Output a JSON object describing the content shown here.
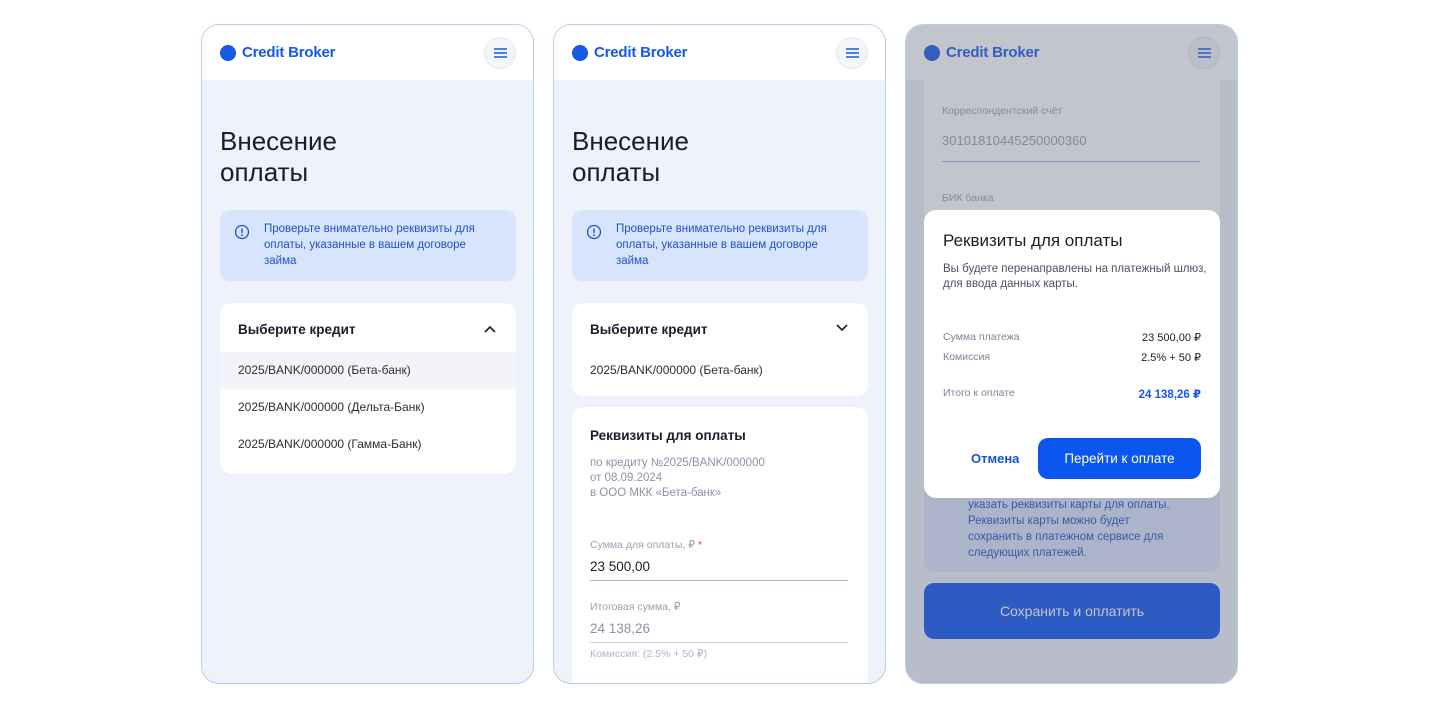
{
  "brand": {
    "name": "Credit Broker"
  },
  "colors": {
    "accent": "#0b55f0",
    "brand": "#1659ea",
    "info_bg": "#d8e4fb",
    "page_bg": "#eff2fb"
  },
  "icons": {
    "menu": "hamburger-icon",
    "info": "info-circle-icon",
    "chevron_up": "chevron-up-icon",
    "chevron_down": "chevron-down-icon"
  },
  "page": {
    "title_line1": "Внесение",
    "title_line2": "оплаты",
    "info_text": "Проверьте внимательно реквизиты для оплаты, указанные в вашем договоре займа"
  },
  "credit_select": {
    "label": "Выберите кредит",
    "options": [
      "2025/BANK/000000 (Бета-банк)",
      "2025/BANK/000000 (Дельта-Банк)",
      "2025/BANK/000000 (Гамма-Банк)"
    ],
    "selected": "2025/BANK/000000 (Бета-банк)"
  },
  "requisites": {
    "title": "Реквизиты для оплаты",
    "line1": "по кредиту №2025/BANK/000000",
    "line2": "от 08.09.2024",
    "line3": "в ООО МКК «Бета-банк»",
    "amount_label": "Сумма для оплаты, ₽",
    "amount_required_mark": "*",
    "amount_value": "23 500,00",
    "total_label": "Итоговая сумма, ₽",
    "total_value": "24 138,26",
    "commission_hint": "Комиссия: (2.5% + 50 ₽)"
  },
  "screen3": {
    "corr_label": "Корреспондентский счёт",
    "corr_value": "30101810445250000360",
    "bik_label": "БИК банка",
    "notice_line1": "указать реквизиты карты для оплаты.",
    "notice_line2": "Реквизиты карты можно будет",
    "notice_line3": "сохранить в платежном сервисе для",
    "notice_line4": "следующих платежей.",
    "save_pay_label": "Сохранить и оплатить"
  },
  "modal": {
    "title": "Реквизиты для оплаты",
    "subtitle": "Вы будете перенаправлены на платежный шлюз, для ввода данных карты.",
    "sum_label": "Сумма платежа",
    "sum_value": "23 500,00 ₽",
    "commission_label": "Комиссия",
    "commission_value": "2.5% + 50 ₽",
    "total_label": "Итого к оплате",
    "total_value": "24 138,26 ₽",
    "cancel_label": "Отмена",
    "go_label": "Перейти к оплате"
  }
}
